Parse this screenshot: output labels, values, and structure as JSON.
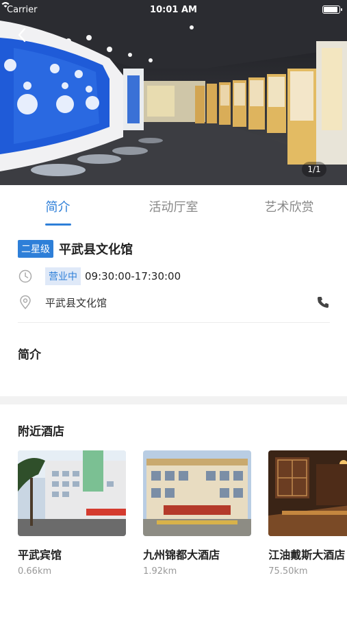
{
  "statusbar": {
    "carrier": "Carrier",
    "time": "10:01 AM"
  },
  "gallery": {
    "counter": "1/1"
  },
  "tabs": [
    {
      "label": "简介"
    },
    {
      "label": "活动厅室"
    },
    {
      "label": "艺术欣赏"
    }
  ],
  "venue": {
    "level": "二星级",
    "name": "平武县文化馆",
    "status": "营业中",
    "hours": "09:30:00-17:30:00",
    "address": "平武县文化馆"
  },
  "intro": {
    "heading": "简介"
  },
  "nearby": {
    "heading": "附近酒店",
    "hotels": [
      {
        "name": "平武宾馆",
        "distance": "0.66km"
      },
      {
        "name": "九州锦都大酒店",
        "distance": "1.92km"
      },
      {
        "name": "江油戴斯大酒店",
        "distance": "75.50km"
      }
    ]
  },
  "colors": {
    "accent": "#2e7fd8",
    "badge_bg": "#dfe9f8"
  }
}
